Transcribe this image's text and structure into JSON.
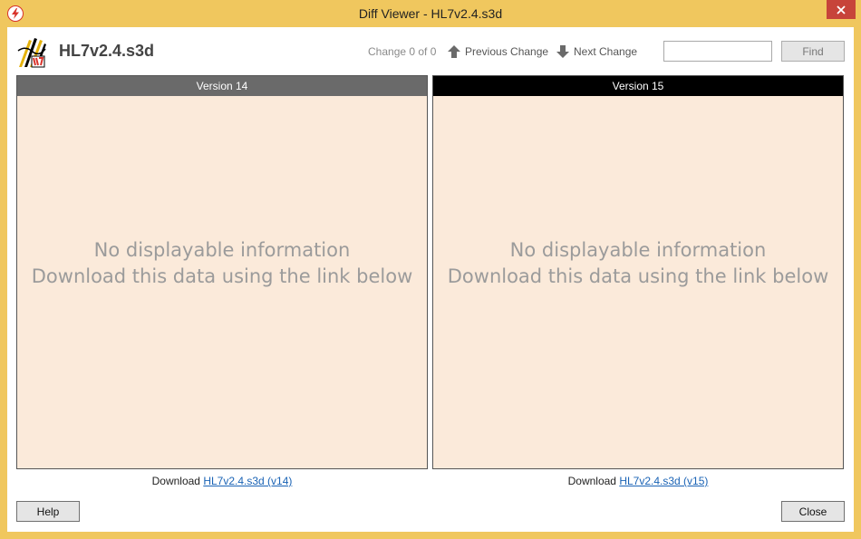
{
  "window": {
    "title": "Diff Viewer - HL7v2.4.s3d",
    "accent_color": "#f0c75e",
    "close_color": "#c7443a"
  },
  "toolbar": {
    "file_title": "HL7v2.4.s3d",
    "change_counter": "Change 0 of 0",
    "previous_change_label": "Previous Change",
    "next_change_label": "Next Change",
    "search_value": "",
    "find_label": "Find",
    "icons": {
      "app": "lightning-icon",
      "prev": "arrow-up-icon",
      "next": "arrow-down-icon",
      "logo": "sdk-logo-icon"
    }
  },
  "panes": [
    {
      "header": "Version 14",
      "header_color": "#6a6a6a",
      "message_line1": "No displayable information",
      "message_line2": "Download this data using the link below",
      "download_prefix": "Download ",
      "download_link": "HL7v2.4.s3d (v14)"
    },
    {
      "header": "Version 15",
      "header_color": "#000000",
      "message_line1": "No displayable information",
      "message_line2": "Download this data using the link below",
      "download_prefix": "Download ",
      "download_link": "HL7v2.4.s3d (v15)"
    }
  ],
  "footer": {
    "help_label": "Help",
    "close_label": "Close"
  }
}
